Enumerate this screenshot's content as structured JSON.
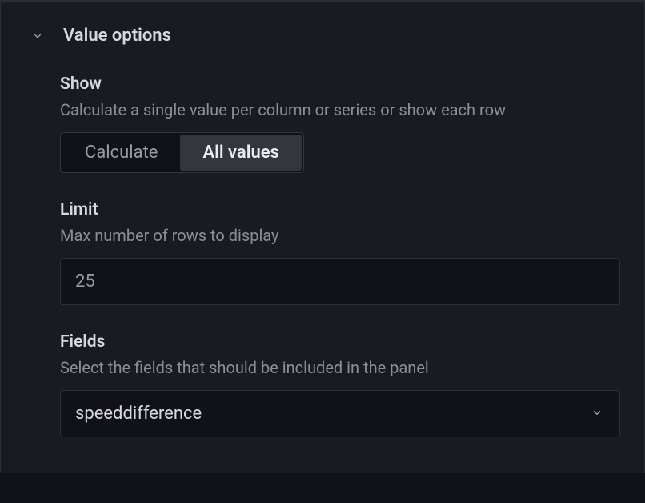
{
  "section": {
    "title": "Value options"
  },
  "show": {
    "label": "Show",
    "description": "Calculate a single value per column or series or show each row",
    "options": {
      "calculate": "Calculate",
      "all_values": "All values"
    },
    "selected": "all_values"
  },
  "limit": {
    "label": "Limit",
    "description": "Max number of rows to display",
    "value": "25"
  },
  "fields": {
    "label": "Fields",
    "description": "Select the fields that should be included in the panel",
    "selected": "speeddifference"
  }
}
